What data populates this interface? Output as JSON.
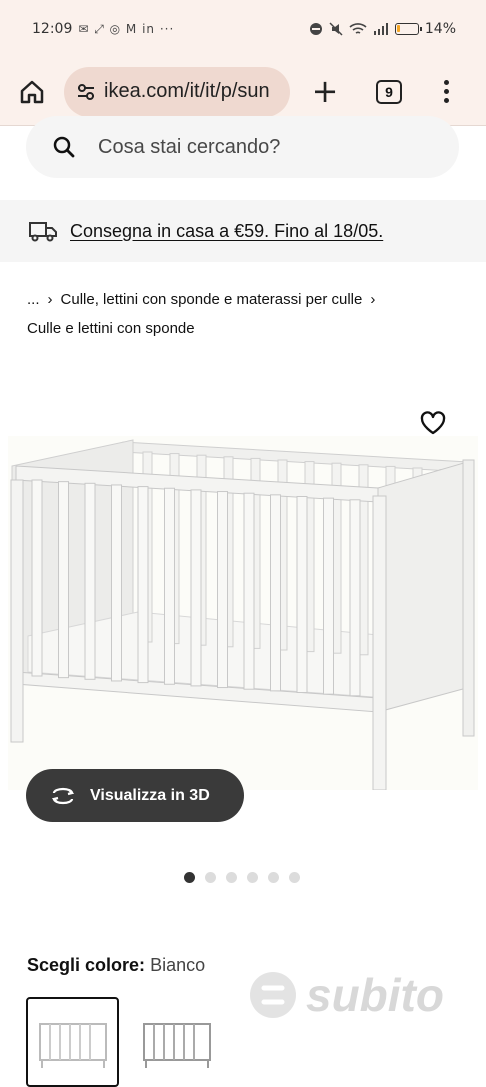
{
  "status_bar": {
    "time": "12:09",
    "notification_icons": "✉ ⤢ ◎ M in ···",
    "battery_level": 0.14,
    "battery_text": "14%"
  },
  "browser": {
    "url": "ikea.com/it/it/p/sun",
    "tab_count": "9"
  },
  "search": {
    "placeholder": "Cosa stai cercando?"
  },
  "delivery": {
    "text": "Consegna in casa a €59. Fino al 18/05."
  },
  "breadcrumb": {
    "ellipsis": "...",
    "item1": "Culle, lettini con sponde e materassi per culle",
    "item2": "Culle e lettini con sponde"
  },
  "product": {
    "view3d_label": "Visualizza in 3D",
    "carousel_active_index": 0,
    "carousel_count": 6
  },
  "color": {
    "label": "Scegli colore:",
    "value": "Bianco"
  },
  "watermark": {
    "text": "subito"
  },
  "colors": {
    "browser_bg": "#fbf1ec",
    "url_pill": "#efd9d0",
    "search_bg": "#f5f5f5",
    "button_dark": "#3a3a3a"
  }
}
